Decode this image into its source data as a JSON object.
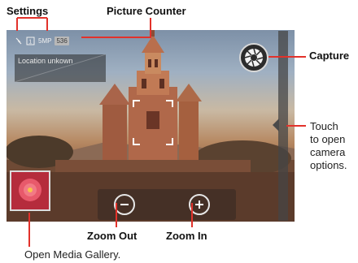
{
  "labels": {
    "settings": "Settings",
    "picture_counter": "Picture Counter",
    "capture": "Capture",
    "touch_note_1": "Touch",
    "touch_note_2": "to open",
    "touch_note_3": "camera",
    "touch_note_4": "options.",
    "zoom_out": "Zoom Out",
    "zoom_in": "Zoom In",
    "open_gallery": "Open Media Gallery."
  },
  "viewfinder": {
    "status_resolution": "5MP",
    "status_counter": "536",
    "location": "Location unkown"
  },
  "icons": {
    "capture": "aperture-icon",
    "zoom_out": "minus-icon",
    "zoom_in": "plus-icon",
    "gallery": "flower-thumbnail",
    "options": "chevron-left-icon"
  },
  "colors": {
    "callout": "#e2322b",
    "text": "#111111"
  }
}
